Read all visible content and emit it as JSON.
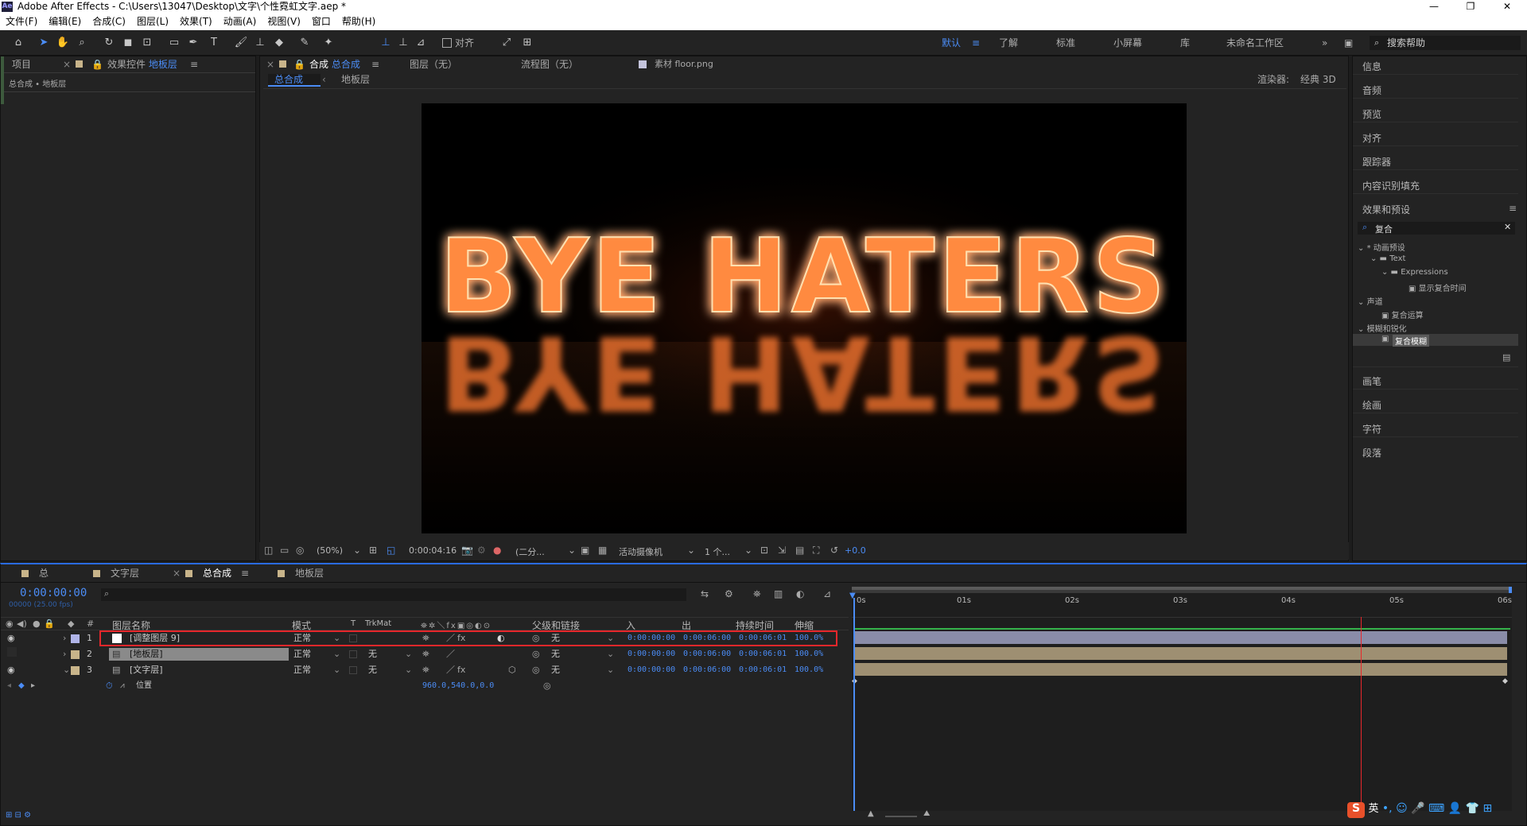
{
  "titlebar": {
    "app_title": "Adobe After Effects - C:\\Users\\13047\\Desktop\\文字\\个性霓虹文字.aep *",
    "logo": "Ae"
  },
  "menu": [
    "文件(F)",
    "编辑(E)",
    "合成(C)",
    "图层(L)",
    "效果(T)",
    "动画(A)",
    "视图(V)",
    "窗口",
    "帮助(H)"
  ],
  "toolbar": {
    "align_label": "对齐",
    "workspaces": [
      "默认",
      "了解",
      "标准",
      "小屏幕",
      "库",
      "未命名工作区"
    ],
    "active_workspace": "默认",
    "search_placeholder": "搜索帮助"
  },
  "project_panel": {
    "tab_project": "项目",
    "tab_effects_prefix": "效果控件",
    "tab_effects_layer": "地板层",
    "breadcrumb": "总合成 • 地板层"
  },
  "comp_panel": {
    "tab_prefix": "合成",
    "tab_name": "总合成",
    "layer_tab": "图层（无）",
    "flow_tab": "流程图（无）",
    "footage_tab": "素材 floor.png",
    "crumb_active": "总合成",
    "crumb_other": "地板层",
    "renderer_label": "渲染器:",
    "renderer_value": "经典 3D",
    "viewer_text": "BYE HATERS",
    "zoom": "(50%)",
    "timecode": "0:00:04:16",
    "resolution": "(二分...",
    "camera": "活动摄像机",
    "views": "1 个...",
    "exposure": "+0.0"
  },
  "right_panel": {
    "items_top": [
      "信息",
      "音频",
      "预览",
      "对齐",
      "跟踪器",
      "内容识别填充"
    ],
    "effects_title": "效果和预设",
    "search_value": "复合",
    "tree": [
      {
        "label": "* 动画预设",
        "level": 0
      },
      {
        "label": "Text",
        "level": 1
      },
      {
        "label": "Expressions",
        "level": 2
      },
      {
        "label": "显示复合时间",
        "level": 3
      },
      {
        "label": "声道",
        "level": 0
      },
      {
        "label": "复合运算",
        "level": 3
      },
      {
        "label": "模糊和锐化",
        "level": 0
      },
      {
        "label": "复合模糊",
        "level": 3,
        "selected": true
      }
    ],
    "items_bottom": [
      "画笔",
      "绘画",
      "字符",
      "段落"
    ]
  },
  "timeline": {
    "tabs": [
      "总",
      "文字层",
      "总合成",
      "地板层"
    ],
    "active_tab": "总合成",
    "current_time": "0:00:00:00",
    "fps_info": "00000 (25.00 fps)",
    "columns": {
      "name": "图层名称",
      "mode": "模式",
      "t": "T",
      "trkmat": "TrkMat",
      "parent": "父级和链接",
      "in": "入",
      "out": "出",
      "duration": "持续时间",
      "stretch": "伸缩"
    },
    "ruler": [
      "0s",
      "01s",
      "02s",
      "03s",
      "04s",
      "05s",
      "06s"
    ],
    "layers": [
      {
        "num": "1",
        "name": "[调整图层 9]",
        "mode": "正常",
        "trkmat": "",
        "parent": "无",
        "in": "0:00:00:00",
        "out": "0:00:06:00",
        "duration": "0:00:06:01",
        "stretch": "100.0%",
        "color": "#b0b4e8",
        "highlighted": true
      },
      {
        "num": "2",
        "name": "[地板层]",
        "mode": "正常",
        "trkmat": "无",
        "parent": "无",
        "in": "0:00:00:00",
        "out": "0:00:06:00",
        "duration": "0:00:06:01",
        "stretch": "100.0%",
        "color": "#c8b48a",
        "highlighted": false
      },
      {
        "num": "3",
        "name": "[文字层]",
        "mode": "正常",
        "trkmat": "无",
        "parent": "无",
        "in": "0:00:00:00",
        "out": "0:00:06:00",
        "duration": "0:00:06:01",
        "stretch": "100.0%",
        "color": "#c8b48a",
        "highlighted": false
      }
    ],
    "property": {
      "name": "位置",
      "value": "960.0,540.0,0.0"
    }
  },
  "ime": {
    "lang": "英"
  },
  "colors": {
    "accent": "#4b8cf5",
    "highlight_box": "#e8272b",
    "adj_bar": "#8a8ca8",
    "footage_bar": "#9e8f72"
  }
}
